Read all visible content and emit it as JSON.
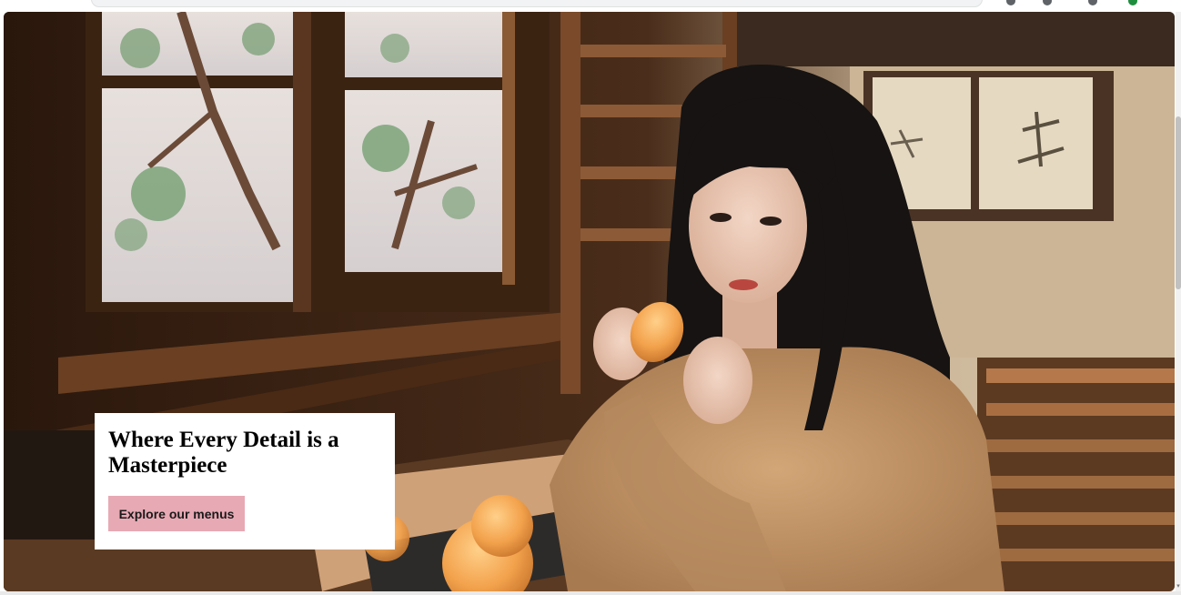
{
  "hero": {
    "headline": "Where Every Detail is a Masterpiece",
    "cta_label": "Explore our menus",
    "image_subject": "woman-eating-persimmon-photo"
  },
  "colors": {
    "cta_background": "#e7a9b4",
    "card_background": "#ffffff",
    "headline_text": "#000000"
  },
  "scrollbar": {
    "arrow_glyph": "▾"
  }
}
